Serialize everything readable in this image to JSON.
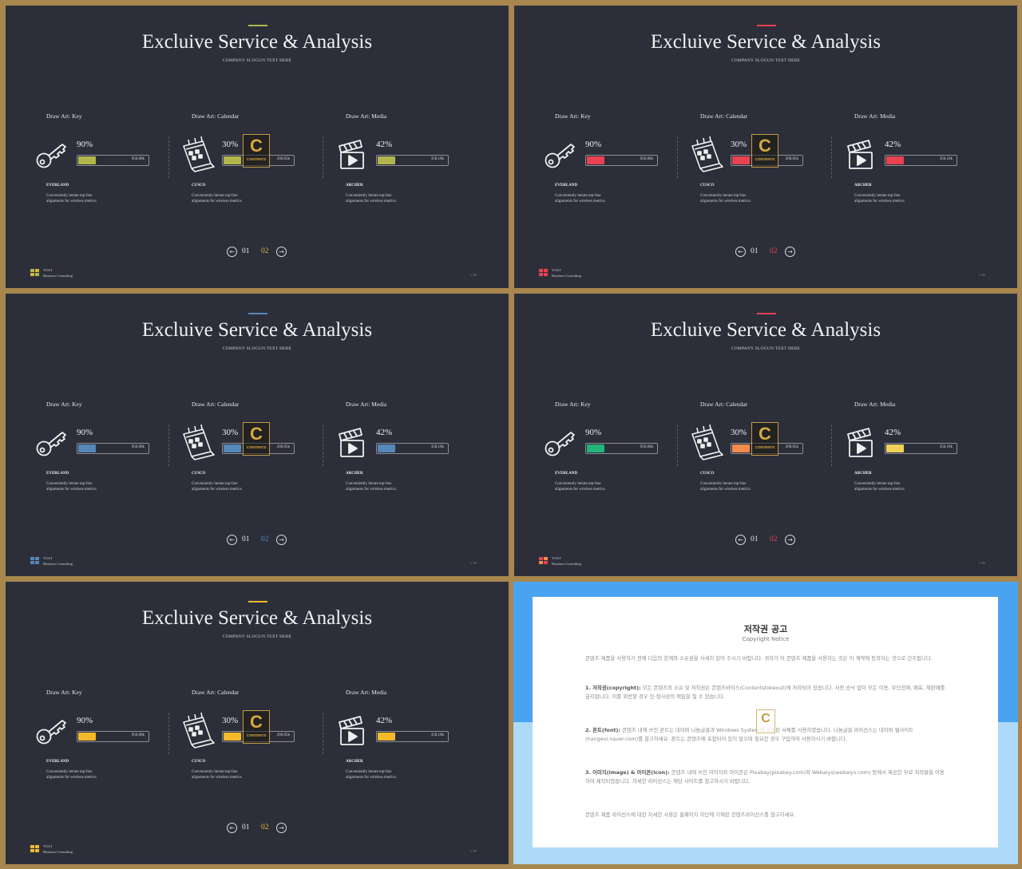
{
  "slides": [
    {
      "title": "Excluіve Service & Analysis",
      "accent": "#b1b64c"
    },
    {
      "title": "Excluіve Service & Analysis",
      "accent": "#e84250"
    },
    {
      "title": "Excluіve Service & Analysis",
      "accent": "#5687b8"
    },
    {
      "title": "Excluіve Service & Analysis",
      "accent": "#e84250"
    },
    {
      "title": "Excluіve Service & Analysis",
      "accent": "#f3b92b"
    }
  ],
  "shared": {
    "title": "Excluive Service & Analysis",
    "slogan": "COMPANY SLOGUN TEXT HERE",
    "cards": [
      {
        "title": "Draw Art: Key",
        "icon": "key-icon",
        "percent_label": "90%",
        "percent": 0.25,
        "amount": "950,00k",
        "name": "EVERLAND",
        "desc1": "Conveniently iterate top-line",
        "desc2": "alignments for wireless metrics."
      },
      {
        "title": "Draw Art: Calendar",
        "icon": "calendar-icon",
        "percent_label": "30%",
        "percent": 0.25,
        "amount": "200,05k",
        "name": "CUSCO",
        "desc1": "Conveniently iterate top-line",
        "desc2": "alignments for wireless metrics."
      },
      {
        "title": "Draw Art: Media",
        "icon": "clapperboard-icon",
        "percent_label": "42%",
        "percent": 0.25,
        "amount": "350,10k",
        "name": "ARCHER",
        "desc1": "Conveniently iterate top-line",
        "desc2": "alignments for wireless metrics."
      }
    ],
    "pager": {
      "page1": "01",
      "page2": "02"
    },
    "brand_name": "VOLT",
    "brand_sub": "Business  Consulting",
    "page_number": "// 01",
    "badge_letter": "C",
    "badge_text": "CONTENTS"
  },
  "color_sets": [
    {
      "fills": [
        "#b1b64c",
        "#b1b64c",
        "#b1b64c"
      ],
      "pager_active": "#d9b43a",
      "logo": "#b1b64c",
      "logo2": "#d9b43a"
    },
    {
      "fills": [
        "#e84250",
        "#e84250",
        "#e84250"
      ],
      "pager_active": "#e84250",
      "logo": "#e84250",
      "logo2": "#e84250"
    },
    {
      "fills": [
        "#5687b8",
        "#5687b8",
        "#5687b8"
      ],
      "pager_active": "#5687b8",
      "logo": "#5687b8",
      "logo2": "#5687b8"
    },
    {
      "fills": [
        "#22b47a",
        "#f58a4d",
        "#f2d15b"
      ],
      "pager_active": "#e84250",
      "logo": "#e84250",
      "logo2": "#f58a4d"
    },
    {
      "fills": [
        "#f3b92b",
        "#f3b92b",
        "#f3b92b"
      ],
      "pager_active": "#f3b92b",
      "logo": "#f3b92b",
      "logo2": "#f3b92b"
    }
  ],
  "notice": {
    "title": "저작권 공고",
    "subtitle": "Copyright Notice",
    "p1": "콘텐츠 제품을 사용하기 전에 다음의 한계와 소유권을 사세히 읽어 주시기 바랍니다. 귀하가 이 콘텐츠 제품을 사용하는 것은 이 계약에 동의하는 것으로 간주됩니다.",
    "p2_head": "1. 저작권(copyright):",
    "p2": " 모든 콘텐츠의 소유 및 저작권은 콘텐츠바이스(Contentstokeout)에 저작되어 있습니다. 사전 승낙 없이 모든 이용, 무단전재, 배포, 재판매를 금지합니다. 이를 위반할 경우 민·형사상의 책임을 질 수 있습니다.",
    "p3_head": "2. 폰트(font):",
    "p3": " 콘텐츠 내에 쓰인 폰트는 네이버 나눔글꼴과 Windows System에 포함된 서체를 사용하였습니다. 나눔글꼴 라이선스는 네이버 웹사이트(hangeul.naver.com)를 참고하세요. 폰트는 콘텐츠에 포함되어 있지 않으며 필요한 경우 구입하여 사용하시기 바랍니다.",
    "p4_head": "3. 이미지(image) & 아이콘(icon):",
    "p4": " 콘텐츠 내에 쓰인 이미지와 아이콘은 Pixabay(pixabay.com)와 Webalys(webalys.com) 등에서 제공한 무료 저작물을 이용하여 제작되었습니다. 자세한 라이선스는 해당 사이트를 참고하시기 바랍니다.",
    "p5": "콘텐츠 제품 라이선스에 대한 자세한 사항은 홈페이지 하단에 기재된 콘텐츠라이선스를 참고하세요."
  }
}
